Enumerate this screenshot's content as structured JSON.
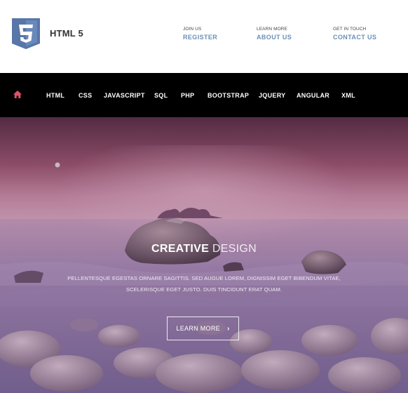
{
  "brand": {
    "name": "HTML 5",
    "logo_digit": "5"
  },
  "header_links": [
    {
      "small": "JOIN US",
      "big": "REGISTER"
    },
    {
      "small": "LEARN MORE",
      "big": "ABOUT US"
    },
    {
      "small": "GET IN TOUCH",
      "big": "CONTACT US"
    }
  ],
  "nav": {
    "home_icon": "home-icon",
    "items": [
      "HTML",
      "CSS",
      "JAVASCRIPT",
      "SQL",
      "PHP",
      "BOOTSTRAP",
      "JQUERY",
      "ANGULAR",
      "XML"
    ]
  },
  "hero": {
    "heading_strong": "CREATIVE",
    "heading_light": "DESIGN",
    "text_line1": "PELLENTESQUE EGESTAS ORNARE SAGITTIS. SED AUGUE LOREM, DIGNISSIM EGET BIBENDUM VITAE,",
    "text_line2": "SCELERISQUE EGET JUSTO. DUIS TINCIDUNT ERAT QUAM.",
    "button_label": "LEARN MORE",
    "button_icon": "chevron-right-icon"
  },
  "colors": {
    "logo_blue": "#5876a8",
    "link_blue": "#6a8fb7",
    "nav_bg": "#000000",
    "home_icon": "#e0506a",
    "hero_sky_top": "#6b3a54",
    "hero_sky_mid": "#c27a98",
    "hero_water": "#8e78a8"
  }
}
